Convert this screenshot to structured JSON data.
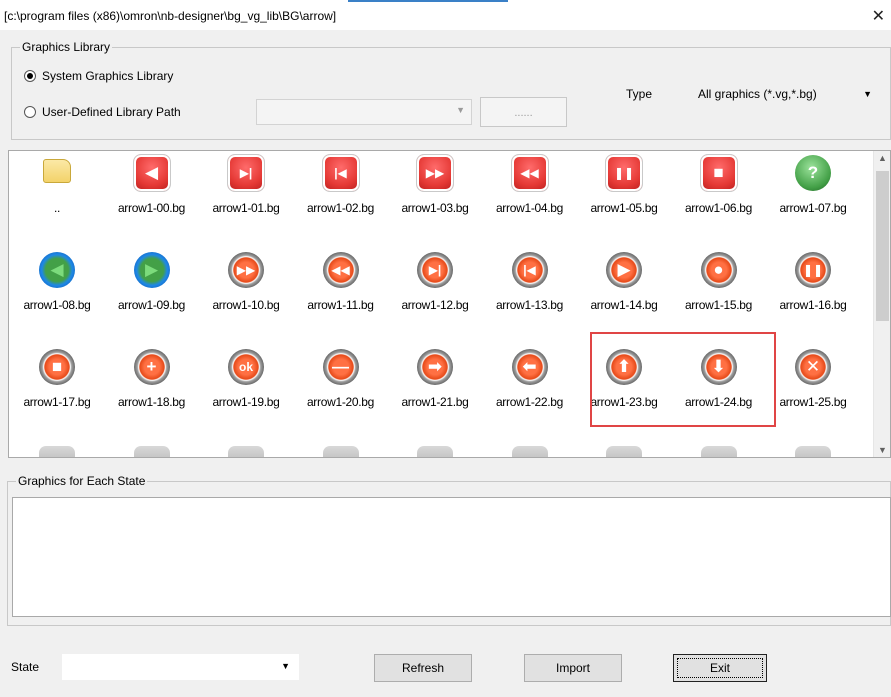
{
  "window": {
    "title": "[c:\\program files (x86)\\omron\\nb-designer\\bg_vg_lib\\BG\\arrow]",
    "close": "✕"
  },
  "graphics_library": {
    "legend": "Graphics Library",
    "system_option": "System Graphics Library",
    "user_option": "User-Defined Library Path",
    "selected": "system",
    "path_value": "",
    "browse_label": "......",
    "type_label": "Type",
    "type_value": "All graphics (*.vg,*.bg)"
  },
  "gallery": {
    "rows": [
      [
        {
          "label": "..",
          "icon": "folder-icon",
          "shape": "folder"
        },
        {
          "label": "arrow1-00.bg",
          "icon": "arrow-left-icon",
          "shape": "red",
          "glyph": "◀"
        },
        {
          "label": "arrow1-01.bg",
          "icon": "play-end-icon",
          "shape": "red",
          "glyph": "▶|"
        },
        {
          "label": "arrow1-02.bg",
          "icon": "play-start-icon",
          "shape": "red",
          "glyph": "|◀"
        },
        {
          "label": "arrow1-03.bg",
          "icon": "fast-forward-icon",
          "shape": "red",
          "glyph": "▶▶"
        },
        {
          "label": "arrow1-04.bg",
          "icon": "rewind-icon",
          "shape": "red",
          "glyph": "◀◀"
        },
        {
          "label": "arrow1-05.bg",
          "icon": "pause-icon",
          "shape": "red",
          "glyph": "❚❚"
        },
        {
          "label": "arrow1-06.bg",
          "icon": "stop-icon",
          "shape": "red",
          "glyph": "■"
        },
        {
          "label": "arrow1-07.bg",
          "icon": "help-icon",
          "shape": "green",
          "glyph": "?"
        }
      ],
      [
        {
          "label": "arrow1-08.bg",
          "icon": "left-arrow-icon",
          "shape": "greenblue",
          "glyph": "◀"
        },
        {
          "label": "arrow1-09.bg",
          "icon": "right-arrow-icon",
          "shape": "greenblue",
          "glyph": "▶"
        },
        {
          "label": "arrow1-10.bg",
          "icon": "fast-forward-icon",
          "shape": "grayred",
          "glyph": "▶▶"
        },
        {
          "label": "arrow1-11.bg",
          "icon": "rewind-icon",
          "shape": "grayred",
          "glyph": "◀◀"
        },
        {
          "label": "arrow1-12.bg",
          "icon": "play-end-icon",
          "shape": "grayred",
          "glyph": "▶|"
        },
        {
          "label": "arrow1-13.bg",
          "icon": "play-start-icon",
          "shape": "grayred",
          "glyph": "|◀"
        },
        {
          "label": "arrow1-14.bg",
          "icon": "play-icon",
          "shape": "grayred",
          "glyph": "▶"
        },
        {
          "label": "arrow1-15.bg",
          "icon": "record-icon",
          "shape": "grayred",
          "glyph": "●"
        },
        {
          "label": "arrow1-16.bg",
          "icon": "pause-icon",
          "shape": "grayred",
          "glyph": "❚❚"
        }
      ],
      [
        {
          "label": "arrow1-17.bg",
          "icon": "stop-icon",
          "shape": "grayred",
          "glyph": "■"
        },
        {
          "label": "arrow1-18.bg",
          "icon": "plus-icon",
          "shape": "grayred",
          "glyph": "+"
        },
        {
          "label": "arrow1-19.bg",
          "icon": "ok-icon",
          "shape": "grayred",
          "glyph": "ok"
        },
        {
          "label": "arrow1-20.bg",
          "icon": "minus-icon",
          "shape": "grayred",
          "glyph": "—"
        },
        {
          "label": "arrow1-21.bg",
          "icon": "arrow-right-icon",
          "shape": "grayred",
          "glyph": "➡"
        },
        {
          "label": "arrow1-22.bg",
          "icon": "arrow-left-icon",
          "shape": "grayred",
          "glyph": "⬅"
        },
        {
          "label": "arrow1-23.bg",
          "icon": "arrow-up-icon",
          "shape": "grayred",
          "glyph": "⬆"
        },
        {
          "label": "arrow1-24.bg",
          "icon": "arrow-down-icon",
          "shape": "grayred",
          "glyph": "⬇"
        },
        {
          "label": "arrow1-25.bg",
          "icon": "close-icon",
          "shape": "grayred",
          "glyph": "✕"
        }
      ],
      [
        {
          "label": "",
          "icon": "circle-icon",
          "shape": "gray",
          "glyph": ""
        },
        {
          "label": "",
          "icon": "play-icon",
          "shape": "gray",
          "glyph": "▸"
        },
        {
          "label": "",
          "icon": "back-icon",
          "shape": "gray",
          "glyph": "◂"
        },
        {
          "label": "",
          "icon": "play-end-icon",
          "shape": "gray",
          "glyph": "▶|"
        },
        {
          "label": "",
          "icon": "play-start-icon",
          "shape": "gray",
          "glyph": "|◀"
        },
        {
          "label": "",
          "icon": "pause-icon",
          "shape": "gray",
          "glyph": "❚❚"
        },
        {
          "label": "",
          "icon": "minus-icon",
          "shape": "gray",
          "glyph": "—"
        },
        {
          "label": "",
          "icon": "stop-icon",
          "shape": "gray",
          "glyph": "■"
        },
        {
          "label": "",
          "icon": "pause-icon",
          "shape": "gray",
          "glyph": "❚❚"
        }
      ]
    ]
  },
  "states_section": {
    "legend": "Graphics for Each State"
  },
  "footer": {
    "state_label": "State",
    "state_value": "",
    "refresh_label": "Refresh",
    "import_label": "Import",
    "exit_label": "Exit"
  },
  "colors": {
    "highlight": "#e04545",
    "red_icon": "#e53935",
    "green_icon": "#43a047",
    "blue_ring": "#1e88e5",
    "folder": "#f3d36a"
  }
}
